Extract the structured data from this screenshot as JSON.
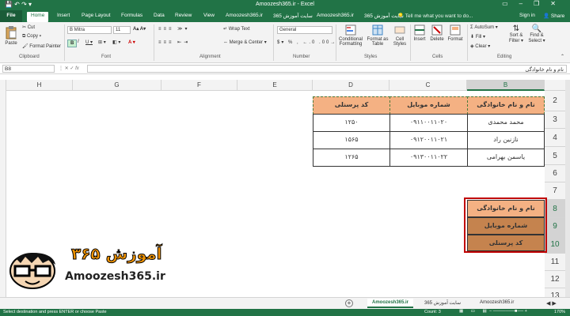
{
  "window": {
    "title": "Amoozesh365.ir - Excel",
    "controls": [
      "–",
      "❐",
      "✕"
    ]
  },
  "tabs": {
    "file": "File",
    "home": "Home",
    "insert": "Insert",
    "page_layout": "Page Layout",
    "formulas": "Formulas",
    "data": "Data",
    "review": "Review",
    "view": "View",
    "site1": "Amoozesh365.ir",
    "site2": "سایت آموزش 365",
    "site3": "Amoozesh365.ir",
    "site4": "سایت آموزش 365",
    "tellme": "Tell me what you want to do...",
    "signin": "Sign in",
    "share": "Share"
  },
  "ribbon": {
    "paste": "Paste",
    "cut": "Cut",
    "copy": "Copy",
    "format_painter": "Format Painter",
    "font_name": "B Mitra",
    "font_size": "11",
    "wrap_text": "Wrap Text",
    "merge_center": "Merge & Center",
    "number_format": "General",
    "conditional": "Conditional",
    "formatting": "Formatting",
    "format_as": "Format as",
    "table": "Table",
    "cell": "Cell",
    "styles_btn": "Styles",
    "insert": "Insert",
    "delete": "Delete",
    "format": "Format",
    "autosum": "AutoSum",
    "fill": "Fill",
    "clear": "Clear",
    "sort": "Sort &",
    "filter": "Filter",
    "find": "Find &",
    "select": "Select",
    "groups": {
      "clipboard": "Clipboard",
      "font": "Font",
      "alignment": "Alignment",
      "number": "Number",
      "styles": "Styles",
      "cells": "Cells",
      "editing": "Editing"
    }
  },
  "formula_bar": {
    "name_box": "B8",
    "content": "نام و نام خانوادگی"
  },
  "columns": [
    "H",
    "G",
    "F",
    "E",
    "D",
    "C",
    "B"
  ],
  "rows": [
    "2",
    "3",
    "4",
    "5",
    "6",
    "7",
    "8",
    "9",
    "10",
    "11",
    "12",
    "13"
  ],
  "table": {
    "headers": {
      "name": "نام و نام خانوادگی",
      "mobile": "شماره موبایل",
      "code": "کد پرسنلی"
    },
    "rows": [
      {
        "name": "محمد محمدی",
        "mobile": "۰۹۱۱۰۰۱۱۰۲۰",
        "code": "۱۲۵۰"
      },
      {
        "name": "نازنین راد",
        "mobile": "۰۹۱۲۰۰۱۱۰۲۱",
        "code": "۱۵۶۵"
      },
      {
        "name": "یاسمن بهرامی",
        "mobile": "۰۹۱۳۰۰۱۱۰۲۲",
        "code": "۱۲۶۵"
      }
    ]
  },
  "transposed": [
    "نام و نام خانوادگی",
    "شماره موبایل",
    "کد پرسنلی"
  ],
  "logo": {
    "persian": "آموزش ۳۶۵",
    "latin": "Amoozesh365.ir"
  },
  "sheet_tabs": [
    "Amoozesh365.ir",
    "سایت آموزش 365",
    "Amoozesh365.ir"
  ],
  "status": {
    "message": "Select destination and press ENTER or choose Paste",
    "count": "Count: 3",
    "zoom": "170%"
  },
  "colors": {
    "excel_green": "#217346",
    "header_fill": "#f4b183",
    "paste_fill": "#c55a11"
  }
}
